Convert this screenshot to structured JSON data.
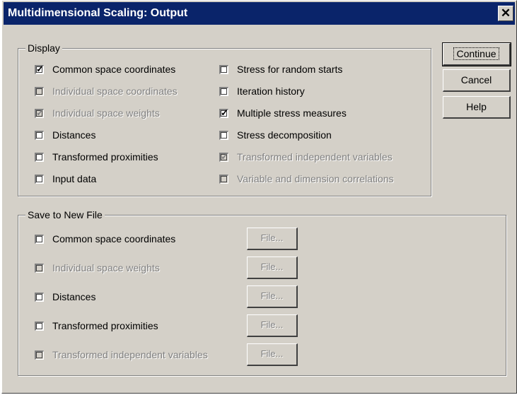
{
  "window": {
    "title": "Multidimensional Scaling: Output",
    "close_glyph": "✕"
  },
  "display": {
    "legend": "Display",
    "left": [
      {
        "label": "Common space coordinates",
        "checked": true,
        "enabled": true
      },
      {
        "label": "Individual space coordinates",
        "checked": false,
        "enabled": false
      },
      {
        "label": "Individual space weights",
        "checked": true,
        "enabled": false
      },
      {
        "label": "Distances",
        "checked": false,
        "enabled": true
      },
      {
        "label": "Transformed proximities",
        "checked": false,
        "enabled": true
      },
      {
        "label": "Input data",
        "checked": false,
        "enabled": true
      }
    ],
    "right": [
      {
        "label": "Stress for random starts",
        "checked": false,
        "enabled": true
      },
      {
        "label": "Iteration history",
        "checked": false,
        "enabled": true
      },
      {
        "label": "Multiple stress measures",
        "checked": true,
        "enabled": true
      },
      {
        "label": "Stress decomposition",
        "checked": false,
        "enabled": true
      },
      {
        "label": "Transformed independent variables",
        "checked": true,
        "enabled": false
      },
      {
        "label": "Variable and dimension correlations",
        "checked": false,
        "enabled": false
      }
    ]
  },
  "save": {
    "legend": "Save to New File",
    "items": [
      {
        "label": "Common space coordinates",
        "checked": false,
        "enabled": true,
        "file_label": "File..."
      },
      {
        "label": "Individual space weights",
        "checked": false,
        "enabled": false,
        "file_label": "File..."
      },
      {
        "label": "Distances",
        "checked": false,
        "enabled": true,
        "file_label": "File..."
      },
      {
        "label": "Transformed proximities",
        "checked": false,
        "enabled": true,
        "file_label": "File..."
      },
      {
        "label": "Transformed independent variables",
        "checked": false,
        "enabled": false,
        "file_label": "File..."
      }
    ]
  },
  "buttons": {
    "continue": "Continue",
    "cancel": "Cancel",
    "help": "Help"
  },
  "colors": {
    "titlebar": "#0a246a",
    "face": "#d4d0c8",
    "disabled_text": "#808080"
  }
}
